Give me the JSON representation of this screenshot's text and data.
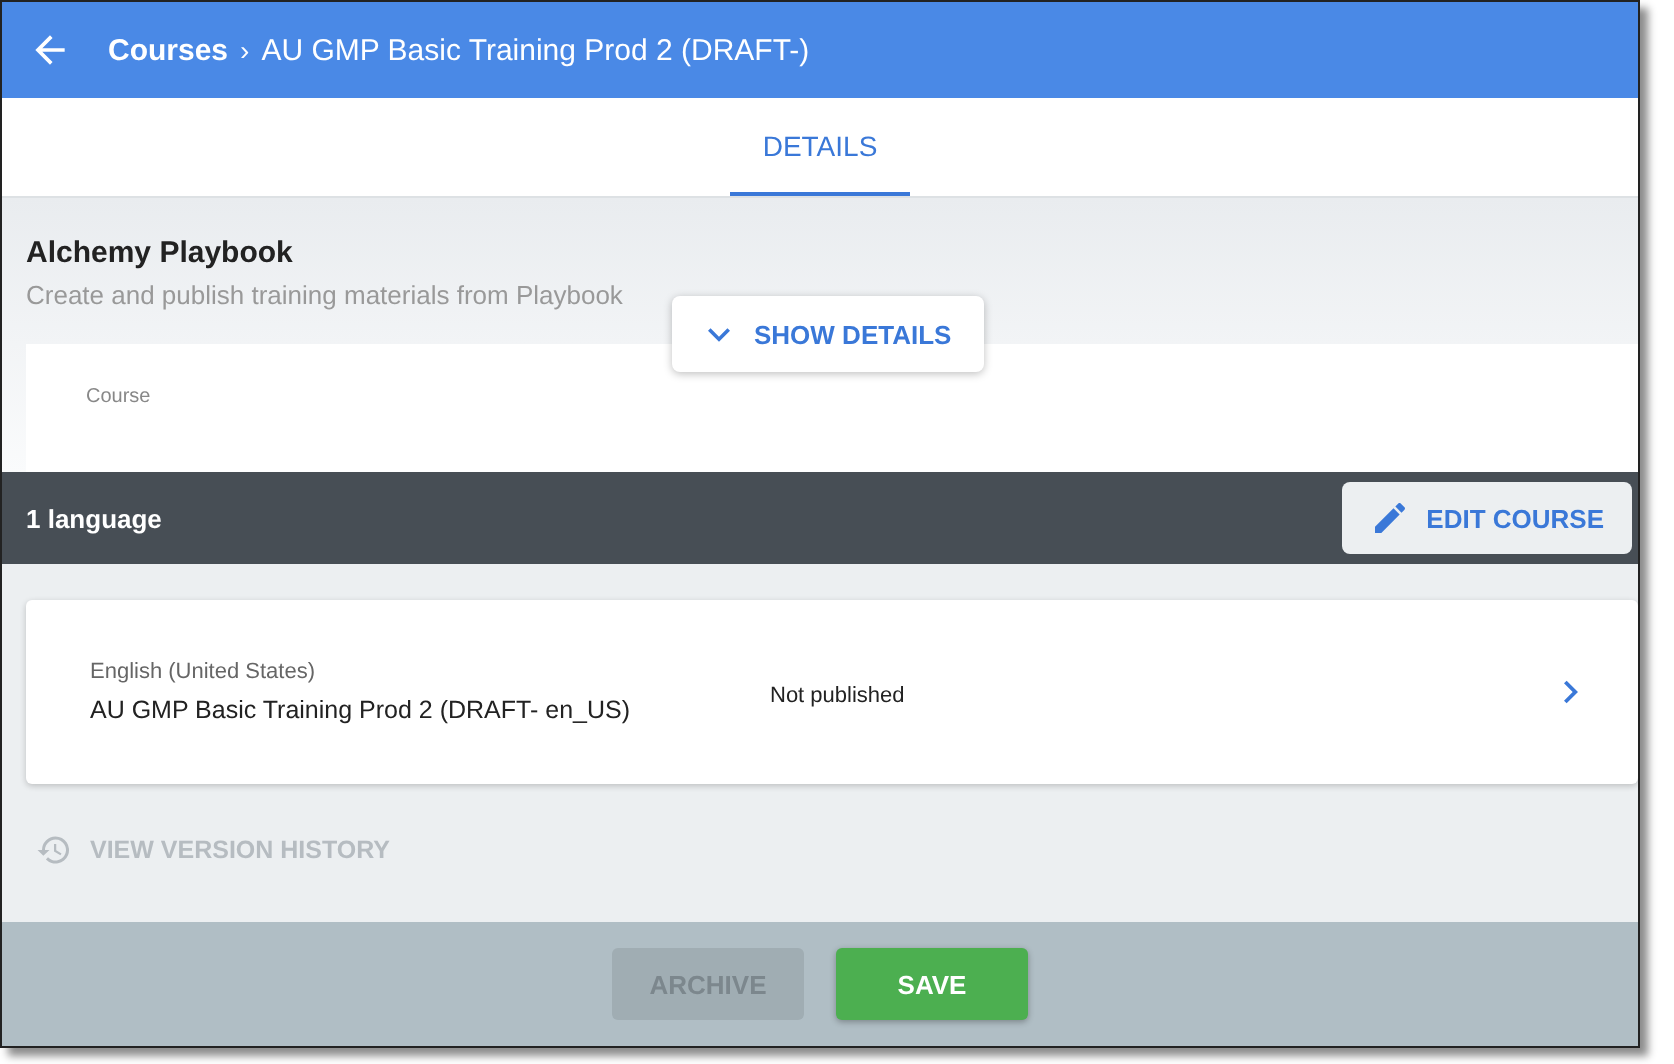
{
  "header": {
    "breadcrumb": "Courses",
    "separator": "›",
    "title": "AU GMP Basic Training Prod 2 (DRAFT-)"
  },
  "tabs": [
    {
      "label": "DETAILS",
      "selected": true
    }
  ],
  "app": {
    "name": "Alchemy Playbook",
    "description": "Create and publish training materials from Playbook",
    "show_details": "SHOW DETAILS",
    "field_label": "Course"
  },
  "language_bar": {
    "count": "1 language",
    "edit_button": "EDIT COURSE"
  },
  "languages": [
    {
      "language": "English (United States)",
      "name": "AU GMP Basic Training Prod 2 (DRAFT- en_US)",
      "status": "Not published"
    }
  ],
  "history_link": {
    "label": "VIEW VERSION HISTORY",
    "disabled": true
  },
  "footer_buttons": [
    {
      "label": "ARCHIVE",
      "kind": "secondary",
      "disabled": true
    },
    {
      "label": "SAVE",
      "kind": "primary",
      "disabled": false
    }
  ]
}
